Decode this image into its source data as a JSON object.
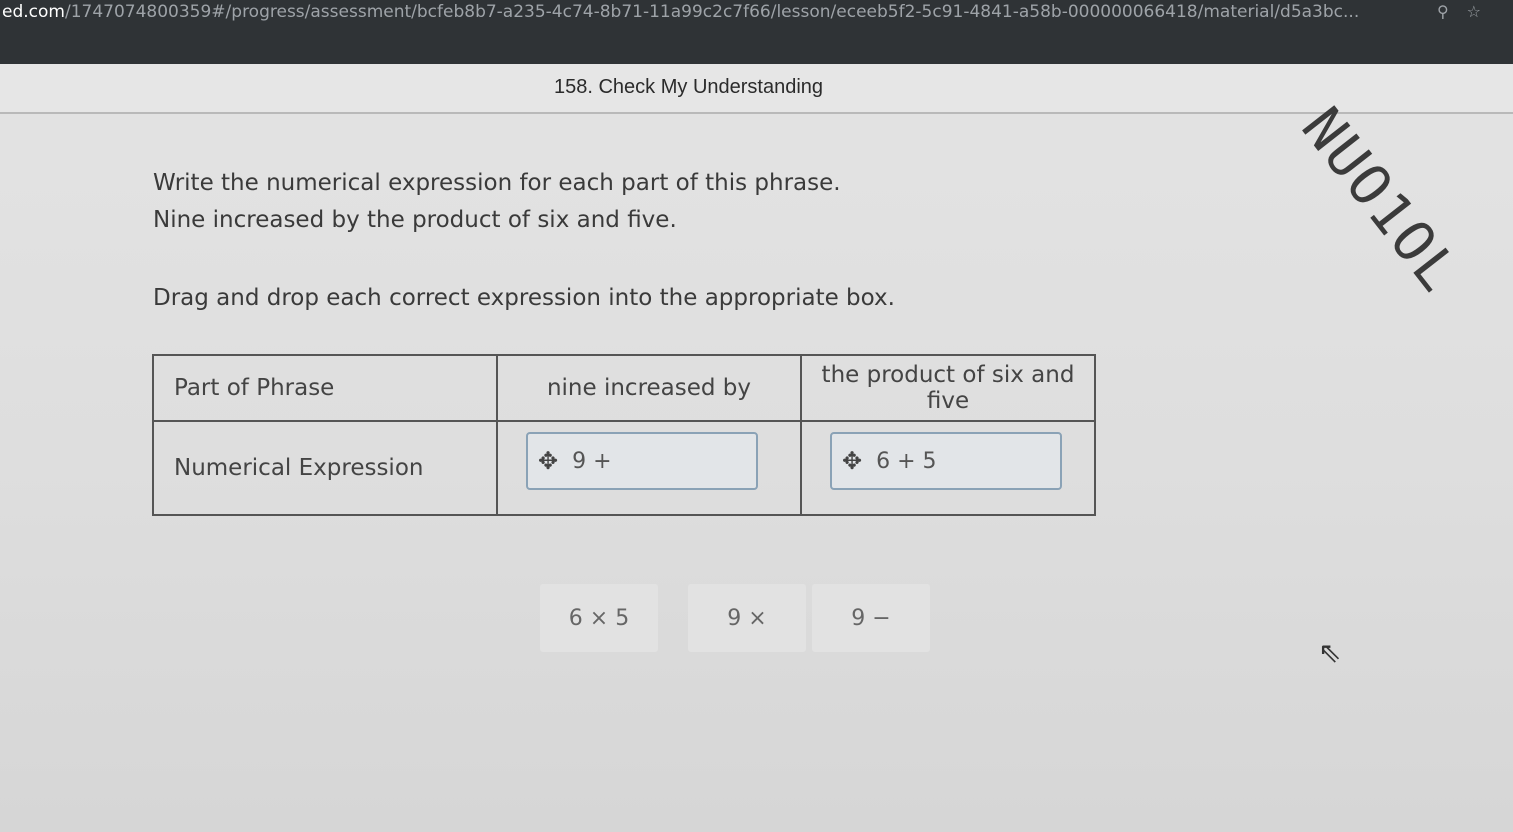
{
  "browser": {
    "url_host": "ed.com",
    "url_path": "/1747074800359#/progress/assessment/bcfeb8b7-a235-4c74-8b71-11a99c2c7f66/lesson/eceeb5f2-5c91-4841-a58b-000000066418/material/d5a3bc..."
  },
  "question": {
    "title": "158. Check My Understanding",
    "tag": "NUO1OL",
    "line1": "Write the numerical expression for each part of this phrase.",
    "line2": "Nine increased by the product of six and five.",
    "line3": "Drag and drop each correct expression into the appropriate box."
  },
  "table": {
    "header": [
      "Part of Phrase",
      "nine increased by",
      "the product of six and five"
    ],
    "row_label": "Numerical Expression",
    "placed": [
      "9 +",
      "6 + 5"
    ]
  },
  "choices": [
    "6 × 5",
    "9 ×",
    "9 −"
  ],
  "icons": {
    "move": "move-arrows-icon",
    "cursor": "mouse-pointer-icon",
    "search": "search-icon",
    "star": "bookmark-star-icon"
  }
}
